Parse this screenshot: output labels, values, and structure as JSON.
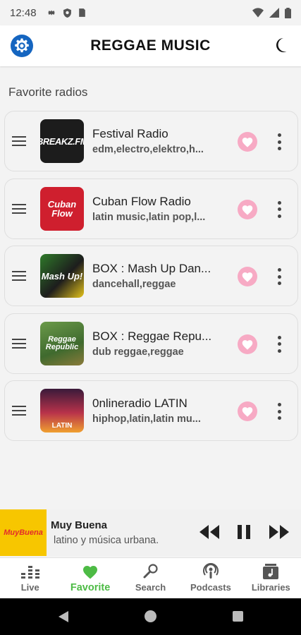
{
  "status_bar": {
    "time": "12:48"
  },
  "header": {
    "title": "REGGAE MUSIC"
  },
  "section": {
    "title": "Favorite radios"
  },
  "radios": [
    {
      "name": "Festival Radio",
      "tags": "edm,electro,elektro,h...",
      "logo_text": "BREAKZ.FM",
      "logo_bg": "#1c1c1c",
      "logo_color": "#ffffff"
    },
    {
      "name": "Cuban Flow Radio",
      "tags": "latin music,latin pop,l...",
      "logo_text": "Cuban Flow",
      "logo_bg": "#cf1f2e",
      "logo_color": "#ffffff"
    },
    {
      "name": "BOX : Mash Up Dan...",
      "tags": "dancehall,reggae",
      "logo_text": "Mash Up!",
      "logo_bg": "#2f7a2a",
      "logo_color": "#ffffff"
    },
    {
      "name": "BOX : Reggae Repu...",
      "tags": "dub reggae,reggae",
      "logo_text": "Reggae Republic",
      "logo_bg": "#4e7a3a",
      "logo_color": "#ffffff"
    },
    {
      "name": "0nlineradio LATIN",
      "tags": "hiphop,latin,latin mu...",
      "logo_text": "LATIN",
      "logo_bg": "#b8324a",
      "logo_color": "#ffffff"
    }
  ],
  "player": {
    "name": "Muy Buena",
    "description": "latino y música urbana.",
    "art_text": "MuyBuena"
  },
  "nav": [
    {
      "label": "Live",
      "icon": "equalizer-icon",
      "active": false
    },
    {
      "label": "Favorite",
      "icon": "heart-icon",
      "active": true
    },
    {
      "label": "Search",
      "icon": "search-mic-icon",
      "active": false
    },
    {
      "label": "Podcasts",
      "icon": "podcast-icon",
      "active": false
    },
    {
      "label": "Libraries",
      "icon": "library-icon",
      "active": false
    }
  ],
  "colors": {
    "accent_green": "#4dbb45",
    "heart_pink": "#f7aac4",
    "heart_fill": "#ffffff",
    "settings_blue": "#1565c0",
    "player_art_bg": "#f7c600"
  }
}
